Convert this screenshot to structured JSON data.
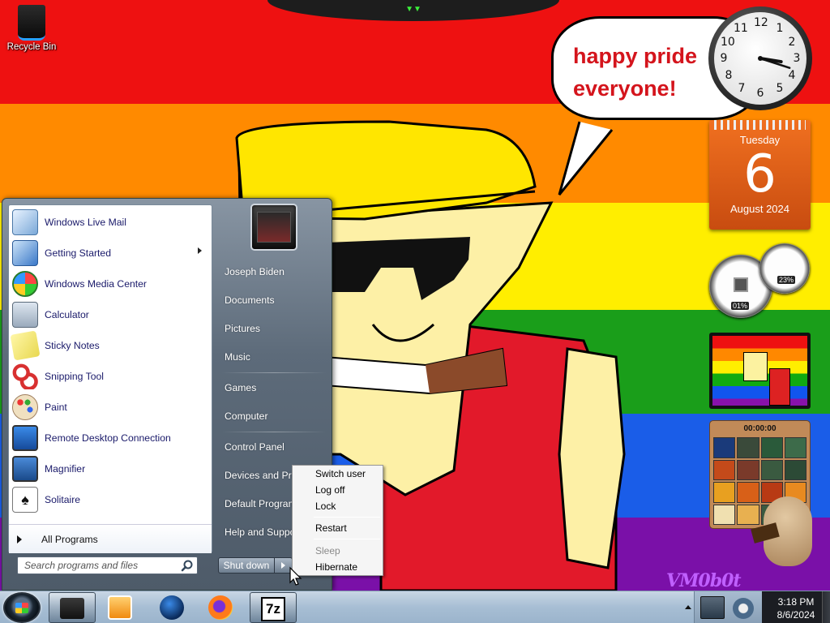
{
  "desktop": {
    "recycle_bin_label": "Recycle Bin",
    "speech_text": "happy pride\neveryone!",
    "watermark": "VM0b0t"
  },
  "gadgets": {
    "clock": {
      "numbers": [
        "12",
        "1",
        "2",
        "3",
        "4",
        "5",
        "6",
        "7",
        "8",
        "9",
        "10",
        "11"
      ],
      "hour": 3,
      "minute": 18
    },
    "calendar": {
      "weekday": "Tuesday",
      "day": "6",
      "month_year": "August 2024"
    },
    "cpu_meter": {
      "cpu": "01%",
      "memory": "23%"
    },
    "puzzle": {
      "timer": "00:00:00"
    }
  },
  "start_menu": {
    "programs": [
      {
        "label": "Windows Live Mail",
        "icon": "mail-icon",
        "has_submenu": false
      },
      {
        "label": "Getting Started",
        "icon": "getting-started-icon",
        "has_submenu": true
      },
      {
        "label": "Windows Media Center",
        "icon": "media-center-icon",
        "has_submenu": false
      },
      {
        "label": "Calculator",
        "icon": "calculator-icon",
        "has_submenu": false
      },
      {
        "label": "Sticky Notes",
        "icon": "sticky-notes-icon",
        "has_submenu": false
      },
      {
        "label": "Snipping Tool",
        "icon": "scissors-icon",
        "has_submenu": false
      },
      {
        "label": "Paint",
        "icon": "paint-palette-icon",
        "has_submenu": false
      },
      {
        "label": "Remote Desktop Connection",
        "icon": "remote-desktop-icon",
        "has_submenu": false
      },
      {
        "label": "Magnifier",
        "icon": "magnifier-icon",
        "has_submenu": false
      },
      {
        "label": "Solitaire",
        "icon": "cards-icon",
        "has_submenu": false
      }
    ],
    "all_programs_label": "All Programs",
    "search_placeholder": "Search programs and files",
    "right_links": [
      "Joseph Biden",
      "Documents",
      "Pictures",
      "Music",
      "Games",
      "Computer",
      "Control Panel",
      "Devices and Printers",
      "Default Programs",
      "Help and Support"
    ],
    "shutdown_label": "Shut down"
  },
  "shutdown_menu": {
    "items": [
      {
        "label": "Switch user",
        "enabled": true
      },
      {
        "label": "Log off",
        "enabled": true
      },
      {
        "label": "Lock",
        "enabled": true
      },
      {
        "label": "Restart",
        "enabled": true
      },
      {
        "label": "Sleep",
        "enabled": false
      },
      {
        "label": "Hibernate",
        "enabled": true
      }
    ]
  },
  "taskbar": {
    "pinned": [
      {
        "name": "computer-icon",
        "active": true
      },
      {
        "name": "media-player-icon",
        "active": false
      },
      {
        "name": "globe-icon",
        "active": false
      },
      {
        "name": "firefox-icon",
        "active": false
      },
      {
        "name": "7zip-icon",
        "label": "7z",
        "active": true
      }
    ],
    "time": "3:18 PM",
    "date": "8/6/2024"
  },
  "colors": {
    "rainbow": [
      "#ee1111",
      "#ff8a00",
      "#ffee00",
      "#1a9e1a",
      "#1a5de8",
      "#7a10a8"
    ],
    "speech_text": "#d4141c",
    "calendar": "#e8641a"
  }
}
